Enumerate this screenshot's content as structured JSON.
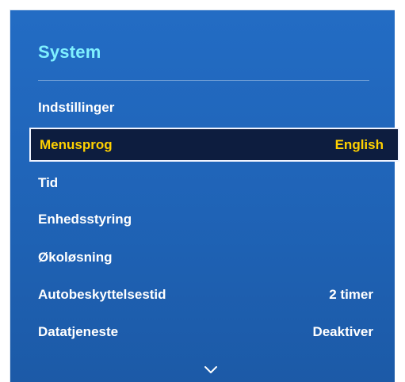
{
  "panel": {
    "title": "System"
  },
  "menu": {
    "items": [
      {
        "label": "Indstillinger",
        "value": ""
      },
      {
        "label": "Menusprog",
        "value": "English"
      },
      {
        "label": "Tid",
        "value": ""
      },
      {
        "label": "Enhedsstyring",
        "value": ""
      },
      {
        "label": "Økoløsning",
        "value": ""
      },
      {
        "label": "Autobeskyttelsestid",
        "value": "2 timer"
      },
      {
        "label": "Datatjeneste",
        "value": "Deaktiver"
      }
    ],
    "more_icon": "chevron-down-icon"
  },
  "colors": {
    "panel_background": "#1f63b6",
    "title": "#7ff0ff",
    "selected_text": "#ffd100",
    "selected_background": "#0d1d3f",
    "text": "#ffffff"
  }
}
